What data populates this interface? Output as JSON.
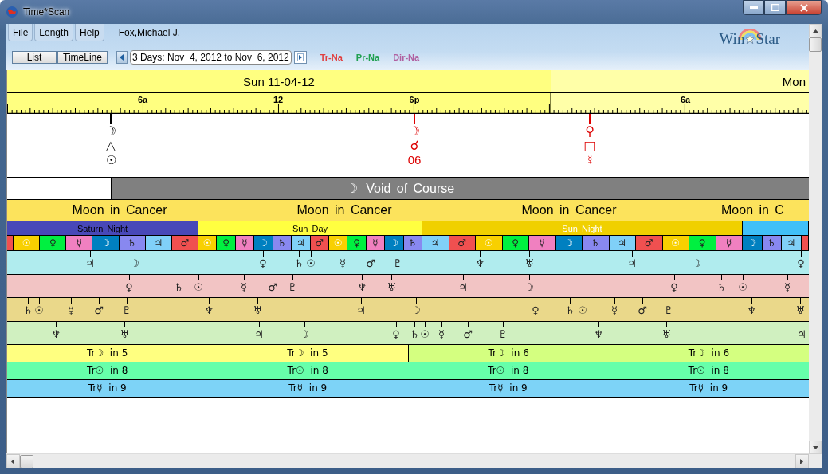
{
  "window": {
    "title": "Time*Scan"
  },
  "menu": [
    "File",
    "Length",
    "Help"
  ],
  "chart_name": "Fox,Michael J.",
  "view_buttons": [
    "List",
    "TimeLine"
  ],
  "date_range": "3 Days: Nov  4, 2012 to Nov  6, 2012",
  "legend": [
    {
      "label": "Tr-Na",
      "color": "#e04040"
    },
    {
      "label": "Pr-Na",
      "color": "#20a050"
    },
    {
      "label": "Dir-Na",
      "color": "#b060a0"
    }
  ],
  "logo": {
    "left": "Win",
    "right": "Star"
  },
  "days": [
    "Sun 11-04-12",
    "Mon"
  ],
  "ruler_labels": [
    "6a",
    "12",
    "6p",
    "6a"
  ],
  "aspect_events": [
    {
      "glyphs": [
        "☽",
        "△",
        "☉"
      ],
      "color": "#000000"
    },
    {
      "glyphs": [
        "☽",
        "☌",
        "06"
      ],
      "color": "#dd0000"
    },
    {
      "glyphs": [
        "♀",
        "□",
        "☿"
      ],
      "color": "#dd0000"
    }
  ],
  "void_of_course": {
    "glyph": "☽",
    "label": "Void of Course"
  },
  "moon_signs": [
    "Moon in Cancer",
    "Moon in Cancer",
    "Moon in Cancer",
    "Moon in C"
  ],
  "planetary_periods": [
    {
      "label": "Saturn Night",
      "color": "#4848b8",
      "hours": [
        {
          "color": "#f05050"
        },
        {
          "glyph": "☉",
          "color": "#f8d000"
        },
        {
          "glyph": "♀",
          "color": "#00f040"
        },
        {
          "glyph": "☿",
          "color": "#f080c0"
        },
        {
          "glyph": "☽",
          "color": "#0080c0"
        },
        {
          "glyph": "♄",
          "color": "#8888f0"
        },
        {
          "glyph": "♃",
          "color": "#80d0f8"
        },
        {
          "glyph": "♂",
          "color": "#f05050"
        }
      ]
    },
    {
      "label": "Sun Day",
      "color": "#ffff40",
      "hours": [
        {
          "glyph": "☉",
          "color": "#f8d000"
        },
        {
          "glyph": "♀",
          "color": "#00f040"
        },
        {
          "glyph": "☿",
          "color": "#f080c0"
        },
        {
          "glyph": "☽",
          "color": "#0080c0"
        },
        {
          "glyph": "♄",
          "color": "#8888f0"
        },
        {
          "glyph": "♃",
          "color": "#80d0f8"
        },
        {
          "glyph": "♂",
          "color": "#f05050"
        },
        {
          "glyph": "☉",
          "color": "#f8d000"
        },
        {
          "glyph": "♀",
          "color": "#00f040"
        },
        {
          "glyph": "☿",
          "color": "#f080c0"
        },
        {
          "glyph": "☽",
          "color": "#0080c0"
        },
        {
          "glyph": "♄",
          "color": "#8888f0"
        }
      ]
    },
    {
      "label": "Sun Night",
      "color": "#f0d000",
      "hours": [
        {
          "glyph": "♃",
          "color": "#80d0f8"
        },
        {
          "glyph": "♂",
          "color": "#f05050"
        },
        {
          "glyph": "☉",
          "color": "#f8d000"
        },
        {
          "glyph": "♀",
          "color": "#00f040"
        },
        {
          "glyph": "☿",
          "color": "#f080c0"
        },
        {
          "glyph": "☽",
          "color": "#0080c0"
        },
        {
          "glyph": "♄",
          "color": "#8888f0"
        },
        {
          "glyph": "♃",
          "color": "#80d0f8"
        },
        {
          "glyph": "♂",
          "color": "#f05050"
        },
        {
          "glyph": "☉",
          "color": "#f8d000"
        },
        {
          "glyph": "♀",
          "color": "#00f040"
        },
        {
          "glyph": "☿",
          "color": "#f080c0"
        }
      ]
    },
    {
      "color": "#40c0f8",
      "hours": [
        {
          "glyph": "☽",
          "color": "#0080c0"
        },
        {
          "glyph": "♄",
          "color": "#8888f0"
        },
        {
          "glyph": "♃",
          "color": "#80d0f8"
        },
        {
          "color": "#f05050"
        }
      ]
    }
  ],
  "transit_rows": [
    {
      "color": "#b0ecee",
      "glyphs": [
        "♃",
        "☽",
        "♀",
        "♄",
        "☉",
        "☿",
        "♂",
        "♇",
        "♆",
        "♅",
        "♃",
        "☽",
        "♀"
      ]
    },
    {
      "color": "#f2c4c4",
      "glyphs": [
        "♀",
        "♄",
        "☉",
        "☿",
        "♂",
        "♇",
        "♆",
        "♅",
        "♃",
        "☽",
        "♀",
        "♄",
        "☉",
        "☿"
      ]
    },
    {
      "color": "#ead88a",
      "glyphs": [
        "♄",
        "☉",
        "☿",
        "♂",
        "♇",
        "♆",
        "♅",
        "♃",
        "☽",
        "♀",
        "♄",
        "☉",
        "☿",
        "♂",
        "♇",
        "♆",
        "♅"
      ]
    },
    {
      "color": "#d0f0c0",
      "glyphs": [
        "♆",
        "♅",
        "♃",
        "☽",
        "♀",
        "♄",
        "☉",
        "☿",
        "♂",
        "♇",
        "♆",
        "♅",
        "♃"
      ]
    }
  ],
  "house_rows": [
    {
      "segments": [
        {
          "color": "#ffff80",
          "labels": [
            "Tr☽  in 5",
            "Tr☽  in 5"
          ]
        },
        {
          "color": "#d4ff80",
          "labels": [
            "Tr☽  in 6",
            "Tr☽  in 6"
          ]
        }
      ]
    },
    {
      "segments": [
        {
          "color": "#66ffaa",
          "labels": [
            "Tr☉  in 8",
            "Tr☉  in 8",
            "Tr☉  in 8",
            "Tr☉  in 8"
          ]
        }
      ]
    },
    {
      "segments": [
        {
          "color": "#7dd3f7",
          "labels": [
            "Tr☿  in 9",
            "Tr☿  in 9",
            "Tr☿  in 9",
            "Tr☿  in 9"
          ]
        }
      ]
    }
  ]
}
